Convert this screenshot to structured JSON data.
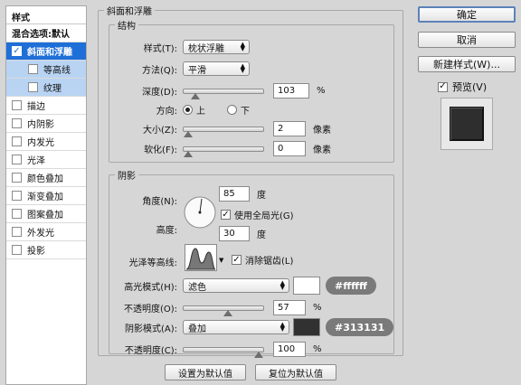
{
  "styles_panel": {
    "header": "样式",
    "items": [
      {
        "label": "混合选项:默认",
        "checkbox": false,
        "checked": false,
        "state": "mixed"
      },
      {
        "label": "斜面和浮雕",
        "checkbox": true,
        "checked": true,
        "state": "active"
      },
      {
        "label": "等高线",
        "checkbox": true,
        "checked": false,
        "state": "sub"
      },
      {
        "label": "纹理",
        "checkbox": true,
        "checked": false,
        "state": "sub"
      },
      {
        "label": "描边",
        "checkbox": true,
        "checked": false,
        "state": "normal"
      },
      {
        "label": "内阴影",
        "checkbox": true,
        "checked": false,
        "state": "normal"
      },
      {
        "label": "内发光",
        "checkbox": true,
        "checked": false,
        "state": "normal"
      },
      {
        "label": "光泽",
        "checkbox": true,
        "checked": false,
        "state": "normal"
      },
      {
        "label": "颜色叠加",
        "checkbox": true,
        "checked": false,
        "state": "normal"
      },
      {
        "label": "渐变叠加",
        "checkbox": true,
        "checked": false,
        "state": "normal"
      },
      {
        "label": "图案叠加",
        "checkbox": true,
        "checked": false,
        "state": "normal"
      },
      {
        "label": "外发光",
        "checkbox": true,
        "checked": false,
        "state": "normal"
      },
      {
        "label": "投影",
        "checkbox": true,
        "checked": false,
        "state": "normal"
      }
    ]
  },
  "bevel": {
    "title": "斜面和浮雕",
    "structure": {
      "title": "结构",
      "style_label": "样式(T):",
      "style_value": "枕状浮雕",
      "technique_label": "方法(Q):",
      "technique_value": "平滑",
      "depth_label": "深度(D):",
      "depth_value": "103",
      "depth_unit": "%",
      "depth_fraction": 0.1,
      "direction_label": "方向:",
      "direction_up": "上",
      "direction_down": "下",
      "direction_selected": "up",
      "size_label": "大小(Z):",
      "size_value": "2",
      "size_unit": "像素",
      "size_fraction": 0.0,
      "soften_label": "软化(F):",
      "soften_value": "0",
      "soften_unit": "像素",
      "soften_fraction": 0.0
    },
    "shading": {
      "title": "阴影",
      "angle_label": "角度(N):",
      "angle_value": "85",
      "angle_unit": "度",
      "global_light_label": "使用全局光(G)",
      "global_light_checked": true,
      "altitude_label": "高度:",
      "altitude_value": "30",
      "altitude_unit": "度",
      "gloss_contour_label": "光泽等高线:",
      "antialias_label": "消除锯齿(L)",
      "antialias_checked": true,
      "highlight_mode_label": "高光模式(H):",
      "highlight_mode_value": "滤色",
      "highlight_color": "#ffffff",
      "highlight_color_label": "#ffffff",
      "highlight_opacity_label": "不透明度(O):",
      "highlight_opacity_value": "57",
      "highlight_opacity_unit": "%",
      "highlight_opacity_fraction": 0.57,
      "shadow_mode_label": "阴影模式(A):",
      "shadow_mode_value": "叠加",
      "shadow_color": "#313131",
      "shadow_color_label": "#313131",
      "shadow_opacity_label": "不透明度(C):",
      "shadow_opacity_value": "100",
      "shadow_opacity_unit": "%",
      "shadow_opacity_fraction": 1.0
    },
    "make_default": "设置为默认值",
    "reset_default": "复位为默认值"
  },
  "right": {
    "ok": "确定",
    "cancel": "取消",
    "new_style": "新建样式(W)...",
    "preview_label": "预览(V)",
    "preview_checked": true
  }
}
